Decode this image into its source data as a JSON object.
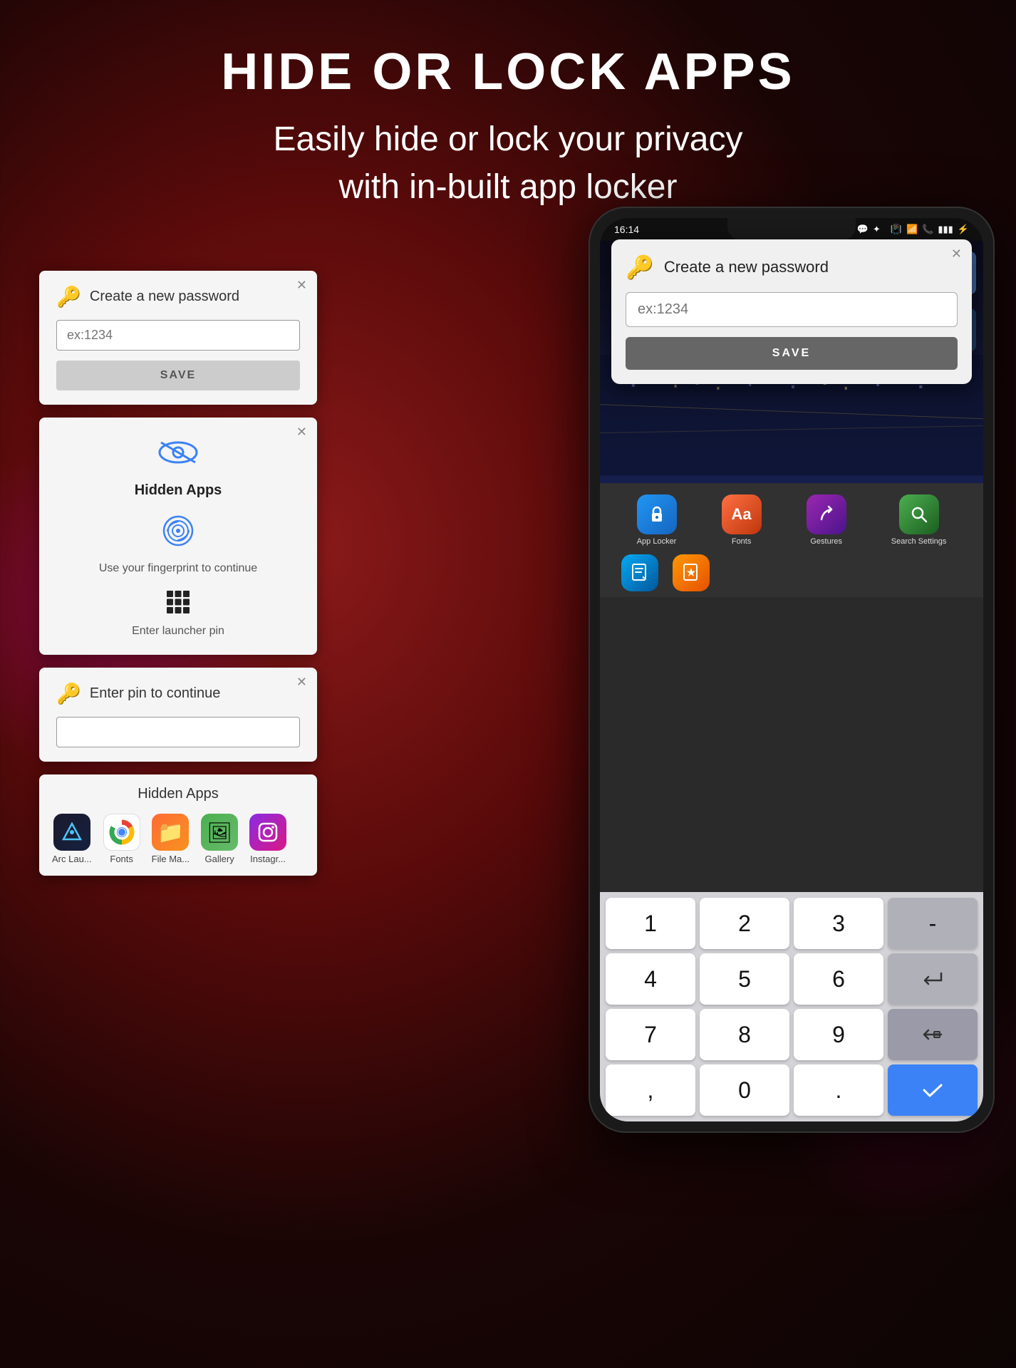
{
  "header": {
    "title": "HIDE OR LOCK APPS",
    "subtitle": "Easily hide or lock your privacy\nwith in-built app locker"
  },
  "panel1": {
    "title": "Create a new password",
    "input_placeholder": "ex:1234",
    "save_label": "SAVE"
  },
  "panel2": {
    "title": "Hidden Apps",
    "fingerprint_text": "Use your fingerprint to continue",
    "pin_text": "Enter launcher pin"
  },
  "panel3": {
    "title": "Enter pin to continue",
    "input_placeholder": ""
  },
  "panel4": {
    "title": "Hidden Apps",
    "apps": [
      {
        "label": "Arc Lau...",
        "icon": "🅐"
      },
      {
        "label": "Chrome",
        "icon": "⊙"
      },
      {
        "label": "File Ma...",
        "icon": "📁"
      },
      {
        "label": "Gallery",
        "icon": "🖼"
      },
      {
        "label": "Instagr...",
        "icon": "📷"
      }
    ]
  },
  "phone": {
    "status_time": "16:14",
    "modal": {
      "title": "Create a new password",
      "input_placeholder": "ex:1234",
      "save_label": "SAVE"
    },
    "drawer": {
      "apps_row1": [
        {
          "label": "App Locker"
        },
        {
          "label": "Fonts"
        },
        {
          "label": "Gestures"
        },
        {
          "label": "Search Settings"
        }
      ]
    },
    "numpad": {
      "keys": [
        "1",
        "2",
        "3",
        "-",
        "4",
        "5",
        "6",
        "⏎",
        "7",
        "8",
        "9",
        "⌫",
        ",",
        "0",
        ".",
        "✓"
      ]
    }
  },
  "colors": {
    "accent_blue": "#3b82f6",
    "bg_dark": "#0d0505",
    "panel_bg": "#f5f5f5"
  }
}
